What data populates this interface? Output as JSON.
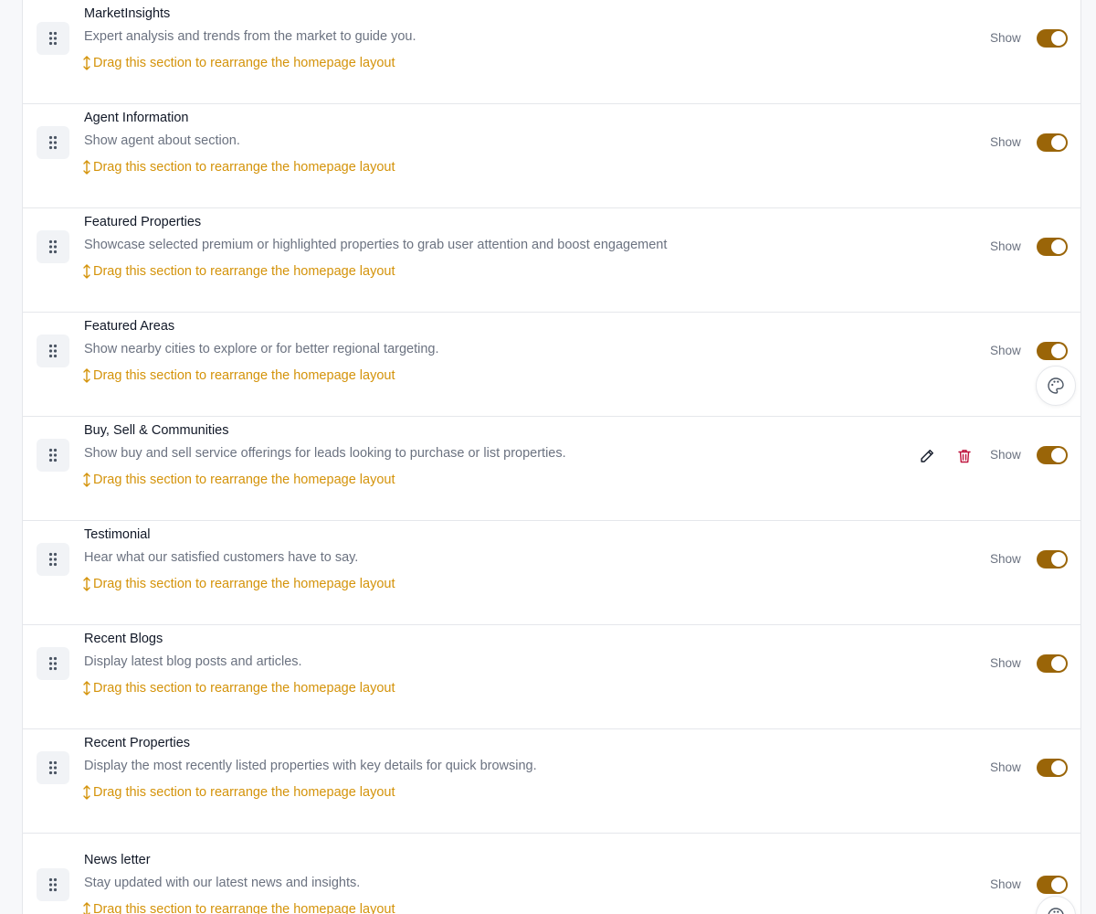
{
  "sections": [
    {
      "title": "MarketInsights",
      "description": "Expert analysis and trends from the market to guide you.",
      "hint": "Drag this section to rearrange the homepage layout",
      "show_label": "Show",
      "enabled": true
    },
    {
      "title": "Agent Information",
      "description": "Show agent about section.",
      "hint": "Drag this section to rearrange the homepage layout",
      "show_label": "Show",
      "enabled": true
    },
    {
      "title": "Featured Properties",
      "description": "Showcase selected premium or highlighted properties to grab user attention and boost engagement",
      "hint": "Drag this section to rearrange the homepage layout",
      "show_label": "Show",
      "enabled": true
    },
    {
      "title": "Featured Areas",
      "description": "Show nearby cities to explore or for better regional targeting.",
      "hint": "Drag this section to rearrange the homepage layout",
      "show_label": "Show",
      "enabled": true
    },
    {
      "title": "Buy, Sell & Communities",
      "description": "Show buy and sell service offerings for leads looking to purchase or list properties.",
      "hint": "Drag this section to rearrange the homepage layout",
      "show_label": "Show",
      "enabled": true
    },
    {
      "title": "Testimonial",
      "description": "Hear what our satisfied customers have to say.",
      "hint": "Drag this section to rearrange the homepage layout",
      "show_label": "Show",
      "enabled": true
    },
    {
      "title": "Recent Blogs",
      "description": "Display latest blog posts and articles.",
      "hint": "Drag this section to rearrange the homepage layout",
      "show_label": "Show",
      "enabled": true
    },
    {
      "title": "Recent Properties",
      "description": "Display the most recently listed properties with key details for quick browsing.",
      "hint": "Drag this section to rearrange the homepage layout",
      "show_label": "Show",
      "enabled": true
    },
    {
      "title": "News letter",
      "description": "Stay updated with our latest news and insights.",
      "hint": "Drag this section to rearrange the homepage layout",
      "show_label": "Show",
      "enabled": true
    }
  ],
  "icons": {
    "handle": "drag-handle-icon",
    "hint": "up-down-arrow-icon",
    "edit": "pencil-icon",
    "delete": "trash-icon",
    "palette": "palette-icon"
  },
  "colors": {
    "accent": "#d4930a",
    "toggle_on": "#9a6508",
    "delete": "#be123c"
  }
}
